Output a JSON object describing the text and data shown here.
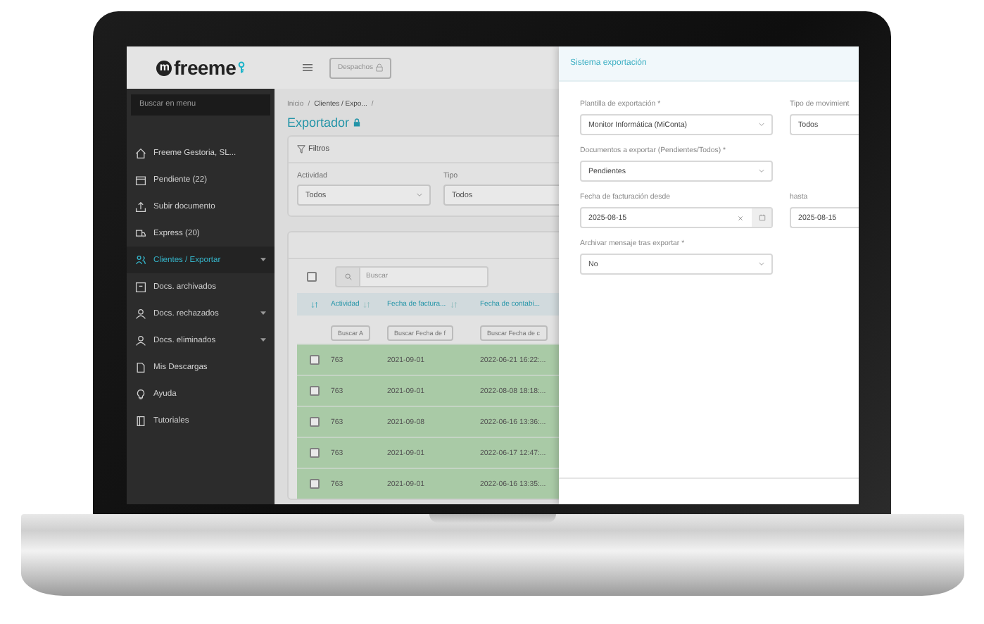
{
  "logo": {
    "mark": "m",
    "text": "freeme"
  },
  "sidebar": {
    "search": {
      "placeholder": "Buscar en menu"
    },
    "items": [
      {
        "label": "Freeme Gestoria, SL...",
        "kind": "home",
        "selected": false,
        "expandable": false
      },
      {
        "label": "Pendiente (22)",
        "kind": "calendar",
        "selected": false,
        "expandable": false
      },
      {
        "label": "Subir documento",
        "kind": "upload",
        "selected": false,
        "expandable": false
      },
      {
        "label": "Express (20)",
        "kind": "truck",
        "selected": false,
        "expandable": false
      },
      {
        "label": "Clientes / Exportar",
        "kind": "people",
        "selected": true,
        "expandable": true
      },
      {
        "label": "Docs. archivados",
        "kind": "box",
        "selected": false,
        "expandable": false
      },
      {
        "label": "Docs. rechazados",
        "kind": "person",
        "selected": false,
        "expandable": true
      },
      {
        "label": "Docs. eliminados",
        "kind": "person",
        "selected": false,
        "expandable": true
      },
      {
        "label": "Mis Descargas",
        "kind": "document",
        "selected": false,
        "expandable": false
      },
      {
        "label": "Ayuda",
        "kind": "bulb",
        "selected": false,
        "expandable": false
      },
      {
        "label": "Tutoriales",
        "kind": "book",
        "selected": false,
        "expandable": false
      }
    ]
  },
  "topbar": {
    "button": "Despachos"
  },
  "breadcrumb": [
    {
      "label": "Inicio",
      "kind": "link"
    },
    {
      "label": "/",
      "kind": "separator"
    },
    {
      "label": "Clientes / Expo...",
      "kind": "current"
    },
    {
      "label": "/",
      "kind": "separator"
    }
  ],
  "title": "Exportador",
  "filters": {
    "title": "Filtros",
    "fields": [
      {
        "label": "Actividad",
        "value": "Todos"
      },
      {
        "label": "Tipo",
        "value": "Todos"
      }
    ]
  },
  "table": {
    "select_all_checked": false,
    "search": {
      "placeholder": "Buscar"
    },
    "columns": [
      "Actividad",
      "Fecha de factura...",
      "Fecha de contabi..."
    ],
    "column_filters": [
      "Buscar A",
      "Buscar Fecha de f",
      "Buscar Fecha de c"
    ],
    "rows": [
      {
        "checked": false,
        "highlighted": true,
        "cells": [
          "763",
          "2021-09-01",
          "2022-06-21 16:22:..."
        ]
      },
      {
        "checked": false,
        "highlighted": true,
        "cells": [
          "763",
          "2021-09-01",
          "2022-08-08 18:18:..."
        ]
      },
      {
        "checked": false,
        "highlighted": true,
        "cells": [
          "763",
          "2021-09-08",
          "2022-06-16 13:36:..."
        ]
      },
      {
        "checked": false,
        "highlighted": true,
        "cells": [
          "763",
          "2021-09-01",
          "2022-06-17 12:47:..."
        ]
      },
      {
        "checked": false,
        "highlighted": true,
        "cells": [
          "763",
          "2021-09-01",
          "2022-06-16 13:35:..."
        ]
      }
    ]
  },
  "drawer": {
    "title": "Sistema exportación",
    "fields": [
      {
        "label": "Plantilla de exportación *",
        "value": "Monitor Informática (MiConta)",
        "kind": "select"
      },
      {
        "label": "Tipo de movimient",
        "value": "Todos",
        "kind": "select-cut"
      },
      {
        "label": "Documentos a exportar (Pendientes/Todos) *",
        "value": "Pendientes",
        "kind": "select"
      },
      {
        "kind": "gap"
      },
      {
        "label": "Fecha de facturación desde",
        "value": "2025-08-15",
        "kind": "date"
      },
      {
        "label": "hasta",
        "value": "2025-08-15",
        "kind": "date-cut"
      },
      {
        "label": "Archivar mensaje tras exportar *",
        "value": "No",
        "kind": "select"
      }
    ]
  }
}
